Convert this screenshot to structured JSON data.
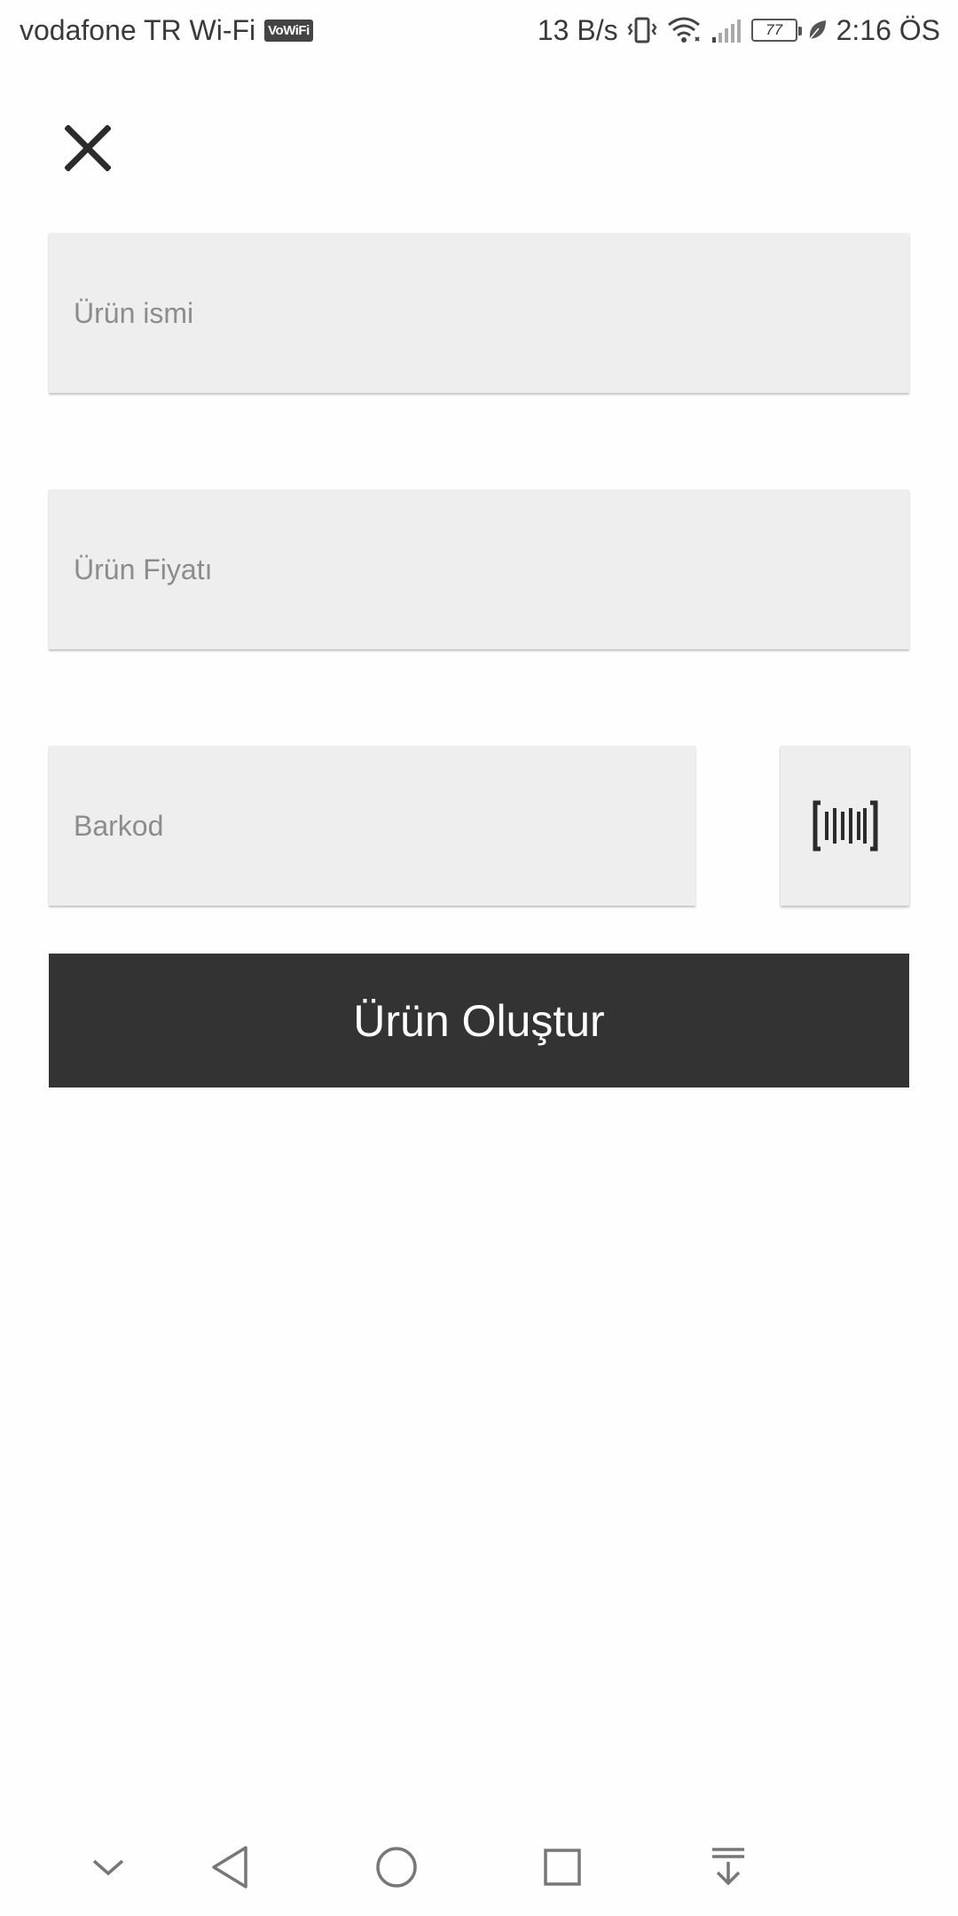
{
  "status_bar": {
    "carrier": "vodafone TR Wi-Fi",
    "vowifi_badge": "VoWiFi",
    "network_speed": "13 B/s",
    "battery_level": "77",
    "time": "2:16 ÖS",
    "icons": [
      "vibrate-icon",
      "wifi-icon",
      "signal-icon",
      "battery-icon",
      "leaf-icon"
    ]
  },
  "header": {
    "close_icon": "close-icon"
  },
  "form": {
    "name_placeholder": "Ürün ismi",
    "name_value": "",
    "price_placeholder": "Ürün Fiyatı",
    "price_value": "",
    "barcode_placeholder": "Barkod",
    "barcode_value": "",
    "scan_icon": "barcode-scan-icon",
    "submit_label": "Ürün Oluştur"
  },
  "nav_bar": {
    "icons": [
      "chevron-down-icon",
      "back-icon",
      "home-icon",
      "recents-icon",
      "notification-pull-icon"
    ]
  },
  "colors": {
    "background": "#fefefe",
    "field_bg": "#eeeeee",
    "button_bg": "#333333",
    "button_text": "#ffffff",
    "placeholder": "#8c8c8c"
  }
}
